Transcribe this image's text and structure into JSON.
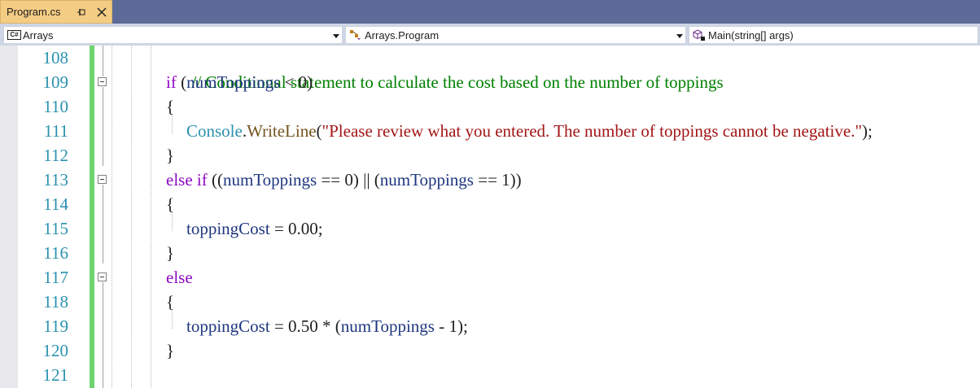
{
  "tab": {
    "title": "Program.cs"
  },
  "navbar": {
    "project": "Arrays",
    "project_badge": "C#",
    "type": "Arrays.Program",
    "member": "Main(string[] args)"
  },
  "line_numbers": [
    "108",
    "109",
    "110",
    "111",
    "112",
    "113",
    "114",
    "115",
    "116",
    "117",
    "118",
    "119",
    "120",
    "121"
  ],
  "code": {
    "l108": {
      "comment": "// Conditional statement to calculate the cost based on the number of toppings"
    },
    "l109": {
      "kw": "if",
      "open": " (",
      "var": "numToppings",
      "rest": " < 0)"
    },
    "l110": {
      "brace": "{"
    },
    "l111": {
      "type": "Console",
      "dot": ".",
      "method": "WriteLine",
      "open": "(",
      "str": "\"Please review what you entered. The number of toppings cannot be negative.\"",
      "close": ");"
    },
    "l112": {
      "brace": "}"
    },
    "l113": {
      "kw": "else if",
      "p1": " ((",
      "var1": "numToppings",
      "p2": " == 0) || (",
      "var2": "numToppings",
      "p3": " == 1))"
    },
    "l114": {
      "brace": "{"
    },
    "l115": {
      "var": "toppingCost",
      "rest": " = 0.00;"
    },
    "l116": {
      "brace": "}"
    },
    "l117": {
      "kw": "else"
    },
    "l118": {
      "brace": "{"
    },
    "l119": {
      "var": "toppingCost",
      "p1": " = 0.50 * (",
      "var2": "numToppings",
      "p2": " - 1);"
    },
    "l120": {
      "brace": "}"
    }
  },
  "colors": {
    "tab_active": "#f5cc84",
    "tabstrip": "#5d6b99",
    "navbar": "#cfd6e5",
    "line_number": "#2b91af",
    "comment": "#008000",
    "keyword": "#8f08c4",
    "identifier": "#1f377f",
    "type": "#2b91af",
    "method": "#74531f",
    "string": "#a31515",
    "change_bar": "#6fd36f"
  },
  "icons": {
    "tab_pin": "pin-icon",
    "tab_close": "close-icon",
    "project": "csharp-project-icon",
    "type": "class-icon",
    "member": "method-icon",
    "dropdown": "chevron-down-icon",
    "fold": "collapse-icon"
  }
}
